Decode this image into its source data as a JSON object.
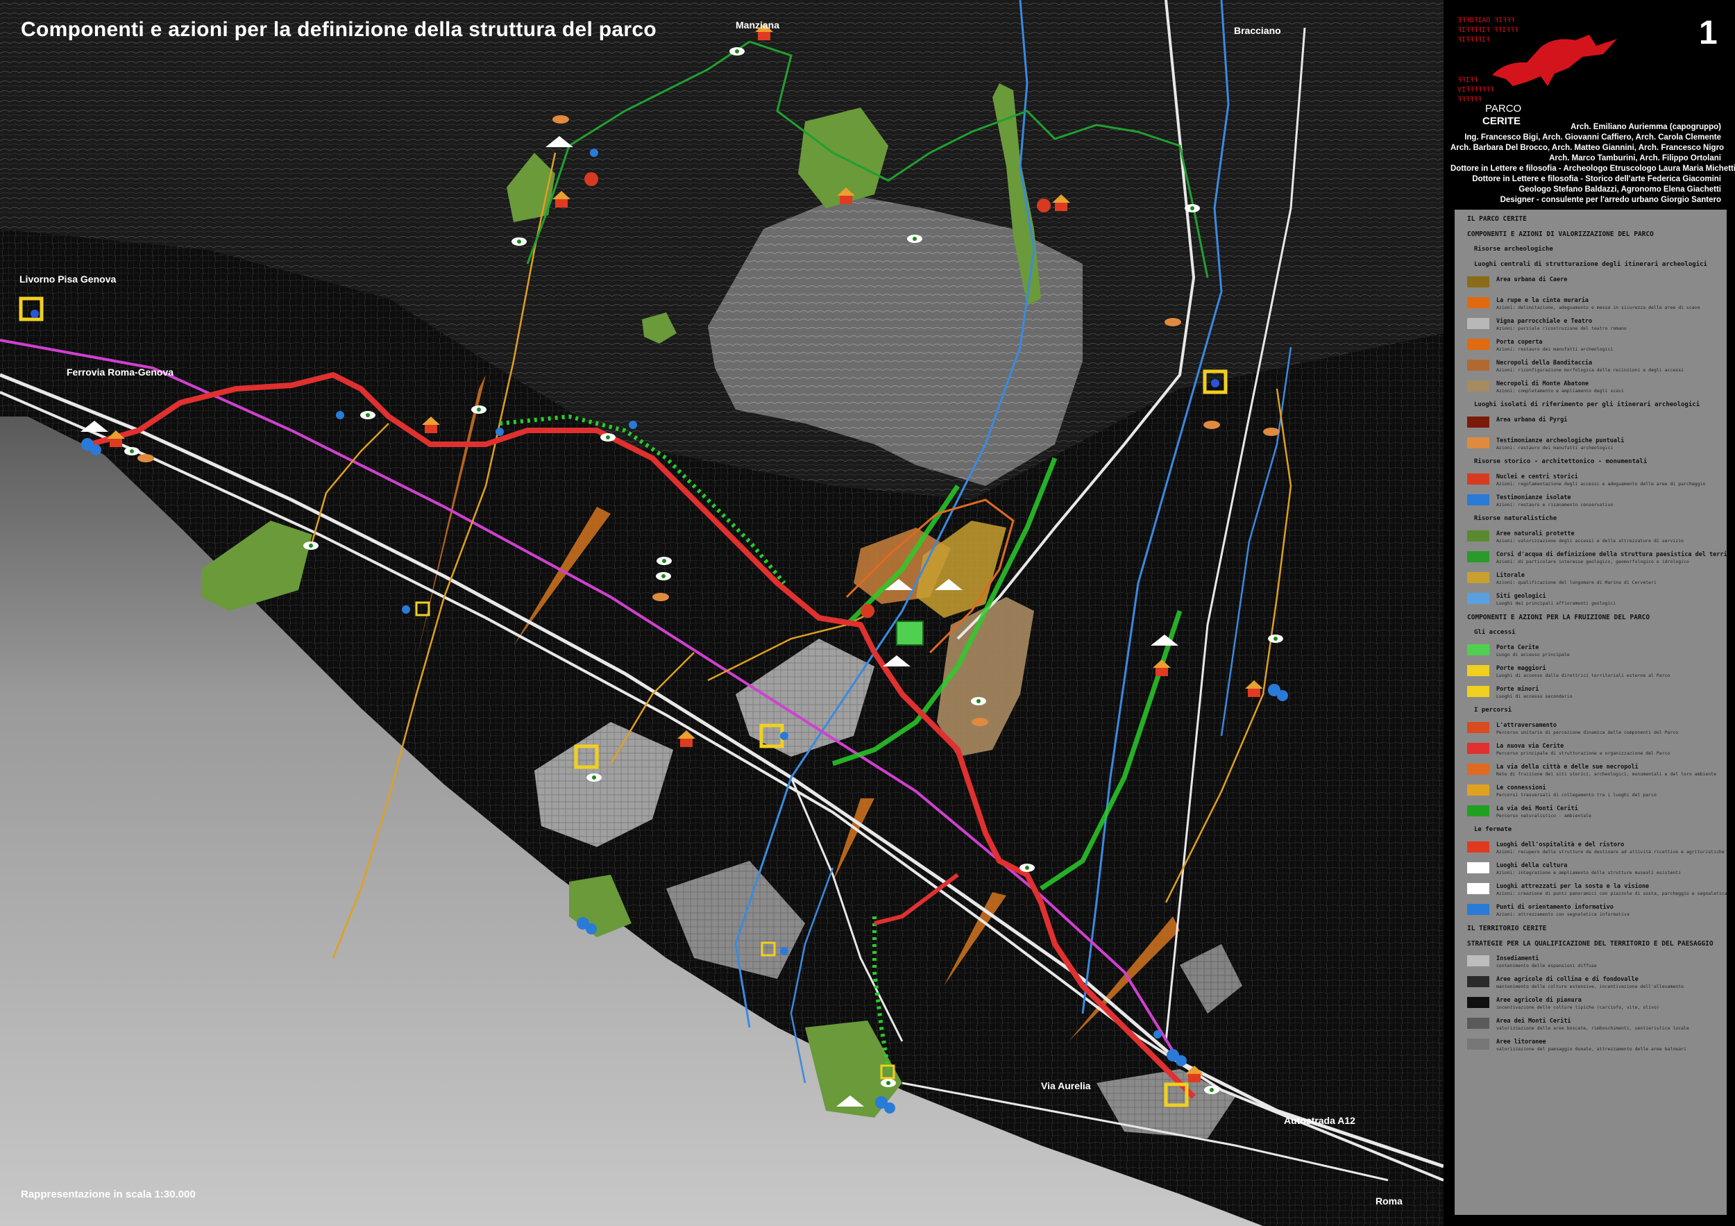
{
  "title": "Componenti e azioni per la definizione della struttura del parco",
  "scale_note": "Rappresentazione in scala 1:30.000",
  "sheet_number": "1",
  "places": [
    {
      "id": "manziana",
      "label": "Manziana"
    },
    {
      "id": "bracciano",
      "label": "Bracciano"
    },
    {
      "id": "livorno",
      "label": "Livorno Pisa Genova"
    },
    {
      "id": "ferrovia",
      "label": "Ferrovia Roma-Genova"
    },
    {
      "id": "aurelia",
      "label": "Via Aurelia"
    },
    {
      "id": "a12",
      "label": "Autostrada A12"
    },
    {
      "id": "roma",
      "label": "Roma"
    }
  ],
  "logo": {
    "lines": [
      "ƎꟻꟻBꟻIAO ꟻIꟻꟻꟻ",
      "ꟻIꟻꟻꟻꟻIꟻ ꟻꟻIꟻꟻꟻ",
      "ꟻIꟻꟻꟻꟻIꟻ",
      "ꟻꟻIꟻꟻ",
      "VIꟻꟻꟻꟻꟻꟻꟻ",
      "ꟻꟻꟻꟻꟻꟻ"
    ],
    "parco": "PARCO",
    "cerite": "CERITE"
  },
  "credits": [
    "Arch. Emiliano Auriemma (capogruppo)",
    "Ing. Francesco Bigi, Arch. Giovanni Caffiero, Arch. Carola Clemente",
    "Arch. Barbara  Del Brocco, Arch. Matteo Giannini, Arch. Francesco Nigro",
    "Arch. Marco Tamburini, Arch. Filippo Ortolani",
    "Dottore in Lettere e filosofia - Archeologo Etruscologo Laura Maria Michetti",
    "Dottore in Lettere e filosofia - Storico dell'arte Federica Giacomini",
    "Geologo Stefano Baldazzi, Agronomo Elena Giachetti",
    "Designer - consulente per l'arredo urbano Giorgio Santero"
  ],
  "legend": {
    "headers": [
      "IL PARCO CERITE",
      "COMPONENTI E AZIONI DI VALORIZZAZIONE DEL PARCO",
      "Risorse archeologiche",
      "Luoghi centrali di strutturazione degli itinerari archeologici",
      "Luoghi isolati di riferimento per gli itinerari archeologici",
      "Risorse storico - architettonico - monumentali",
      "Risorse naturalistiche",
      "COMPONENTI E AZIONI PER LA FRUIZIONE DEL PARCO",
      "Gli accessi",
      "I percorsi",
      "Le fermate",
      "IL TERRITORIO CERITE",
      "STRATEGIE PER LA QUALIFICAZIONE DEL TERRITORIO E DEL PAESAGGIO"
    ],
    "items": [
      {
        "label": "Area urbana di Caere",
        "desc": "",
        "color": "#8a6b1a"
      },
      {
        "label": "La rupe e la cinta muraria",
        "desc": "Azioni: delimitazione, adeguamento e messa in sicurezza delle aree di scavo",
        "color": "#e06a10"
      },
      {
        "label": "Vigna parrocchiale e Teatro",
        "desc": "Azioni: parziale ricostruzione del teatro romano",
        "color": "#b8b8b8"
      },
      {
        "label": "Porta coperta",
        "desc": "Azioni: restauro dei manufatti archeologici",
        "color": "#e06a10"
      },
      {
        "label": "Necropoli della Banditaccia",
        "desc": "Azioni: riconfigurazione morfologica delle recinzioni e degli accessi",
        "color": "#b06a30"
      },
      {
        "label": "Necropoli di Monte Abatone",
        "desc": "Azioni: completamento e ampliamento degli scavi",
        "color": "#a68a60"
      },
      {
        "label": "Area urbana di Pyrgi",
        "desc": "",
        "color": "#7a1a08"
      },
      {
        "label": "Testimonianze archeologiche puntuali",
        "desc": "Azioni: restauro dei manufatti archeologici",
        "color": "#e08a40"
      },
      {
        "label": "Nuclei e centri storici",
        "desc": "Azioni: regolamentazione degli accessi e adeguamento delle aree di parcheggio",
        "color": "#d83a20"
      },
      {
        "label": "Testimonianze isolate",
        "desc": "Azioni: restauro e risanamento conservativo",
        "color": "#2a7ad8"
      },
      {
        "label": "Aree naturali protette",
        "desc": "Azioni: valorizzazione degli accessi e delle attrezzature di servizio",
        "color": "#5a8a30"
      },
      {
        "label": "Corsi d'acqua di definizione della struttura paesistica del territorio degli insediamenti ceriti",
        "desc": "Azioni: di particolare interesse geologico, geomorfologico e idrologico",
        "color": "#2a9a2a"
      },
      {
        "label": "Litorale",
        "desc": "Azioni: qualificazione del lungomare di Marina di Cerveteri",
        "color": "#c8a030"
      },
      {
        "label": "Siti geologici",
        "desc": "Luoghi dei principali affioramenti geologici",
        "color": "#5aa0e0"
      },
      {
        "label": "Porta Cerite",
        "desc": "Luogo di accesso principale",
        "color": "#50d050"
      },
      {
        "label": "Porte maggiori",
        "desc": "Luoghi di accesso dalle direttrici territoriali esterne al Parco",
        "color": "#f0d020"
      },
      {
        "label": "Porte minori",
        "desc": "Luoghi di accesso secondario",
        "color": "#f0d020"
      },
      {
        "label": "L'attraversamento",
        "desc": "Percorso unitario di percezione dinamica delle componenti del Parco",
        "color": "#d84a20"
      },
      {
        "label": "La nuova via Cerite",
        "desc": "Percorso principale di strutturazione e organizzazione del Parco",
        "color": "#e03030"
      },
      {
        "label": "La via della città e delle sue necropoli",
        "desc": "Rete di fruizione dei siti storici, archeologici, monumentali e del loro ambiente",
        "color": "#e06a20"
      },
      {
        "label": "Le connessioni",
        "desc": "Percorsi trasversali di collegamento tra i luoghi del parco",
        "color": "#e0a020"
      },
      {
        "label": "La via dei Monti Ceriti",
        "desc": "Percorso naturalistico - ambientale",
        "color": "#20a020"
      },
      {
        "label": "Luoghi dell'ospitalità e del ristoro",
        "desc": "Azioni: recupero delle strutture da destinare ad attività ricettive e agrituristiche",
        "color": "#e03a20"
      },
      {
        "label": "Luoghi della cultura",
        "desc": "Azioni: integrazione e ampliamento delle strutture museali esistenti",
        "color": "#ffffff"
      },
      {
        "label": "Luoghi attrezzati per la sosta e la visione",
        "desc": "Azioni: creazione di punti panoramici con piazzole di sosta, parcheggio e segnaletica informativa",
        "color": "#ffffff"
      },
      {
        "label": "Punti di orientamento informativo",
        "desc": "Azioni: attrezzamento con segnaletica informativa",
        "color": "#2a7ad8"
      },
      {
        "label": "Insediamenti",
        "desc": "contenimento delle espansioni diffuse",
        "color": "#bdbdbd"
      },
      {
        "label": "Aree agricole di collina e di fondovalle",
        "desc": "mantenimento delle colture estensive, incentivazione dell'allevamento",
        "color": "#2a2a2a"
      },
      {
        "label": "Aree agricole di pianura",
        "desc": "incentivazione delle colture tipiche (carciofo, vite, olivo)",
        "color": "#111111"
      },
      {
        "label": "Area dei Monti Ceriti",
        "desc": "valorizzazione delle aree boscate, rimboschimenti, sentieristica locale",
        "color": "#5a5a5a"
      },
      {
        "label": "Aree litoranee",
        "desc": "valorizzazione del paesaggio dunale, attrezzamento delle aree balneari",
        "color": "#777777"
      }
    ]
  },
  "map_colors": {
    "sea": "#a8a8a8",
    "land": "#0b0b0b",
    "hills": "#6e6e6e",
    "urban": "#b0b0b0",
    "protected": "#6a9a3a",
    "necropolis_banditaccia": "#c07a3a",
    "necropolis_abatone": "#a88a62",
    "nuova_via_cerite": "#e03030",
    "railway": "#d040d0",
    "roads": "#e8e8e8",
    "rivers": "#3a8ae0",
    "connessioni": "#e0a020",
    "monti_ceriti_path": "#20a030",
    "corridor_green": "#2acc2a",
    "porte": "#f0d020",
    "view_cone": "#e07a20"
  }
}
